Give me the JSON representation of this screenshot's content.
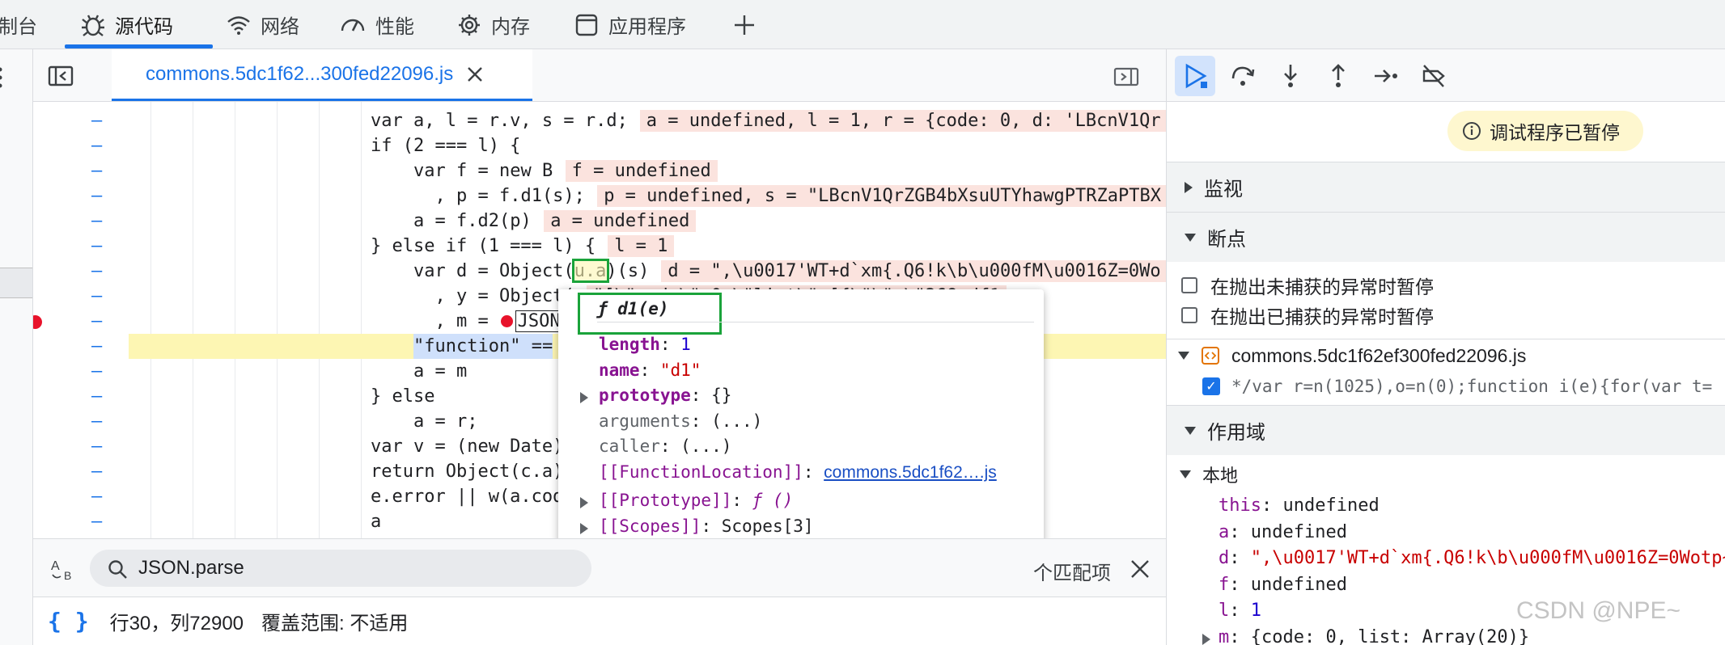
{
  "top_tabs": [
    {
      "label": "制台",
      "icon": "none"
    },
    {
      "label": "源代码",
      "icon": "bug-icon"
    },
    {
      "label": "网络",
      "icon": "wifi-icon"
    },
    {
      "label": "性能",
      "icon": "gauge-icon"
    },
    {
      "label": "内存",
      "icon": "chip-icon"
    },
    {
      "label": "应用程序",
      "icon": "window-icon"
    }
  ],
  "editor": {
    "file_tab": "commons.5dc1f62...300fed22096.js",
    "lines": [
      {
        "indent": 1,
        "code": "var a, l = r.v, s = r.d;",
        "inline": "a = undefined, l = 1, r = {code: 0, d: 'LBcnV1Qr"
      },
      {
        "indent": 1,
        "code": "if (2 === l) {",
        "inline": ""
      },
      {
        "indent": 2,
        "code": "var f = new B",
        "inline": "f = undefined"
      },
      {
        "indent": 2,
        "code": "  , p = f.d1(s);",
        "inline": "p = undefined, s = \"LBcnV1QrZGB4bXsuUTYhawgPTRZaPTBX"
      },
      {
        "indent": 2,
        "code": "a = f.d2(p)",
        "inline": "a = undefined"
      },
      {
        "indent": 1,
        "code": "} else if (1 === l) {",
        "inline": "l = 1"
      },
      {
        "indent": 2,
        "code": "var d = Object(u.a)(s)",
        "inline": "d = \",\\u0017'WT+d`xm{.Q6!k\\b\\u000fM\\u0016Z=0Wo"
      },
      {
        "indent": 2,
        "code": "  , y = Object(",
        "inline": "\"[\\\"code\\\":0,\\\"list\\\":[{\\\"\\\":\\\"368edf1"
      },
      {
        "indent": 2,
        "code": "  , m = ",
        "inline": ""
      },
      {
        "indent": 2,
        "code": "\"function\" ==",
        "inline": ""
      },
      {
        "indent": 2,
        "code": "a = m",
        "inline": ""
      },
      {
        "indent": 1,
        "code": "} else",
        "inline": ""
      },
      {
        "indent": 2,
        "code": "a = r;",
        "inline": ""
      },
      {
        "indent": 1,
        "code": "var v = (new Date)",
        "inline": ""
      },
      {
        "indent": 1,
        "code": "return Object(c.a)",
        "inline": ""
      },
      {
        "indent": 1,
        "code": "e.error || w(a.cod",
        "inline": ""
      },
      {
        "indent": 1,
        "code": "a",
        "inline": ""
      }
    ],
    "paused_marker_text": "JSON"
  },
  "popover": {
    "title": "ƒ d1(e)",
    "rows": [
      {
        "key": "length",
        "value": "1",
        "expand": false
      },
      {
        "key": "name",
        "value": "\"d1\"",
        "expand": false
      },
      {
        "key": "prototype",
        "value": "{}",
        "expand": true
      },
      {
        "key": "arguments",
        "value": "(...)",
        "expand": false
      },
      {
        "key": "caller",
        "value": "(...)",
        "expand": false
      },
      {
        "key": "[[FunctionLocation]]",
        "value": "commons.5dc1f62….js",
        "expand": false
      },
      {
        "key": "[[Prototype]]",
        "value": "ƒ ()",
        "expand": true
      },
      {
        "key": "[[Scopes]]",
        "value": "Scopes[3]",
        "expand": true
      }
    ]
  },
  "search": {
    "value": "JSON.parse",
    "match_text": "个匹配项"
  },
  "status": {
    "position": "行30，列72900",
    "coverage": "覆盖范围: 不适用"
  },
  "right": {
    "paused_badge": "调试程序已暂停",
    "watch": "监视",
    "breakpoints": "断点",
    "pause_uncaught": "在抛出未捕获的异常时暂停",
    "pause_caught": "在抛出已捕获的异常时暂停",
    "bp_file": "commons.5dc1f62ef300fed22096.js",
    "bp_code": "*/var r=n(1025),o=n(0);function i(e){for(var t=",
    "scope": "作用域",
    "local": "本地",
    "vars": [
      {
        "k": "this",
        "v": "undefined"
      },
      {
        "k": "a",
        "v": "undefined"
      },
      {
        "k": "d",
        "v": "\",\\u0017'WT+d`xm{.Q6!k\\b\\u000fM\\u0016Z=0Wotp~"
      },
      {
        "k": "f",
        "v": "undefined"
      },
      {
        "k": "l",
        "v": "1"
      },
      {
        "k": "m",
        "v": "{code: 0, list: Array(20)}"
      }
    ],
    "watermark": "CSDN @NPE~"
  },
  "colors": {
    "accent": "#1a73e8",
    "breakpoint": "#e8132b",
    "highlight": "#fdf6b3",
    "inline_bg": "#fbe3de"
  }
}
